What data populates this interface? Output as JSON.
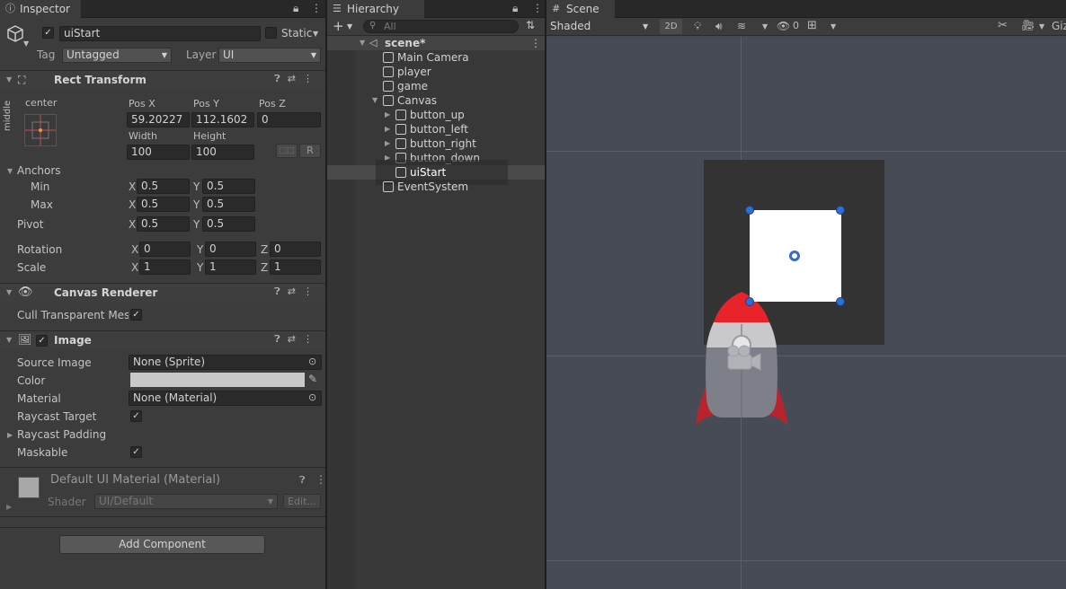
{
  "inspector": {
    "tab_label": "Inspector",
    "object_name": "uiStart",
    "static_label": "Static",
    "tag_label": "Tag",
    "tag_value": "Untagged",
    "layer_label": "Layer",
    "layer_value": "UI",
    "rect_transform": {
      "title": "Rect Transform",
      "anchor_preset_h": "center",
      "anchor_preset_v": "middle",
      "pos_x_label": "Pos X",
      "pos_x": "59.20227",
      "pos_y_label": "Pos Y",
      "pos_y": "112.1602",
      "pos_z_label": "Pos Z",
      "pos_z": "0",
      "width_label": "Width",
      "width": "100",
      "height_label": "Height",
      "height": "100",
      "r_button": "R",
      "anchors_label": "Anchors",
      "min_label": "Min",
      "min_x": "0.5",
      "min_y": "0.5",
      "max_label": "Max",
      "max_x": "0.5",
      "max_y": "0.5",
      "pivot_label": "Pivot",
      "pivot_x": "0.5",
      "pivot_y": "0.5",
      "rotation_label": "Rotation",
      "rot_x": "0",
      "rot_y": "0",
      "rot_z": "0",
      "scale_label": "Scale",
      "scale_x": "1",
      "scale_y": "1",
      "scale_z": "1",
      "axis_x": "X",
      "axis_y": "Y",
      "axis_z": "Z"
    },
    "canvas_renderer": {
      "title": "Canvas Renderer",
      "cull_label": "Cull Transparent Mesh"
    },
    "image": {
      "title": "Image",
      "source_image_label": "Source Image",
      "source_image_value": "None (Sprite)",
      "color_label": "Color",
      "color_value": "#c8c8c8",
      "material_label": "Material",
      "material_value": "None (Material)",
      "raycast_target_label": "Raycast Target",
      "raycast_padding_label": "Raycast Padding",
      "maskable_label": "Maskable"
    },
    "material_asset": {
      "title": "Default UI Material (Material)",
      "shader_label": "Shader",
      "shader_value": "UI/Default",
      "edit_button": "Edit..."
    },
    "add_component": "Add Component"
  },
  "hierarchy": {
    "tab_label": "Hierarchy",
    "search_placeholder": "All",
    "scene_name": "scene*",
    "items": [
      {
        "label": "Main Camera"
      },
      {
        "label": "player"
      },
      {
        "label": "game"
      },
      {
        "label": "Canvas"
      },
      {
        "label": "button_up"
      },
      {
        "label": "button_left"
      },
      {
        "label": "button_right"
      },
      {
        "label": "button_down"
      },
      {
        "label": "uiStart"
      },
      {
        "label": "EventSystem"
      }
    ]
  },
  "scene": {
    "tab_label": "Scene",
    "shading_mode": "Shaded",
    "mode_2d": "2D",
    "hidden_count": "0",
    "gizmos_label": "Giz"
  },
  "colors": {
    "selection": "#2c5d87",
    "rocket_red": "#e8232a",
    "handle_blue": "#2e6fd6"
  }
}
